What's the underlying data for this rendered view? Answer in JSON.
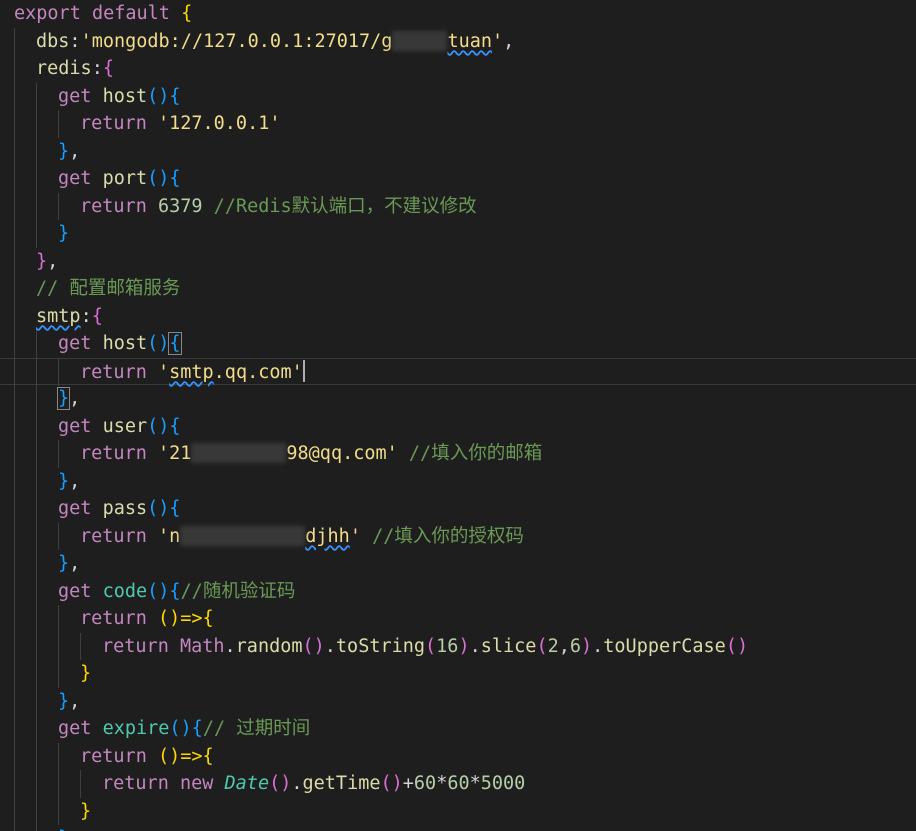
{
  "colors": {
    "keyword": "#c586c0",
    "control": "#c586c0",
    "variable": "#9cdcfe",
    "property": "#9cdcfe",
    "function": "#dcdcaa",
    "string": "#ce9178",
    "number": "#b5cea8",
    "comment": "#6a9955",
    "plain": "#d4d4d4",
    "class": "#4ec9b0",
    "bracket1": "#ffd700",
    "bracket2": "#da70d6",
    "bracket3": "#179fff"
  },
  "lines": [
    {
      "indent": 0,
      "tokens": [
        {
          "t": "export",
          "c": "#c586c0"
        },
        {
          "t": " "
        },
        {
          "t": "default",
          "c": "#c586c0"
        },
        {
          "t": " "
        },
        {
          "t": "{",
          "c": "#ffd700"
        }
      ]
    },
    {
      "indent": 1,
      "tokens": [
        {
          "t": "dbs",
          "c": "#dcdcaa"
        },
        {
          "t": ":",
          "c": "#d4d4d4"
        },
        {
          "t": "'mongodb://127.0.0.1:27017/",
          "c": "#f1dd8a"
        },
        {
          "t": "g",
          "c": "#f1dd8a"
        },
        {
          "redact": 55
        },
        {
          "t": "tuan",
          "c": "#f1dd8a",
          "squig": true
        },
        {
          "t": "'",
          "c": "#f1dd8a"
        },
        {
          "t": ",",
          "c": "#d4d4d4"
        }
      ]
    },
    {
      "indent": 1,
      "tokens": [
        {
          "t": "redis",
          "c": "#dcdcaa"
        },
        {
          "t": ":",
          "c": "#d4d4d4"
        },
        {
          "t": "{",
          "c": "#da70d6"
        }
      ]
    },
    {
      "indent": 2,
      "tokens": [
        {
          "t": "get",
          "c": "#c586c0"
        },
        {
          "t": " "
        },
        {
          "t": "host",
          "c": "#dcdcaa"
        },
        {
          "t": "()",
          "c": "#179fff"
        },
        {
          "t": "{",
          "c": "#179fff"
        }
      ]
    },
    {
      "indent": 3,
      "tokens": [
        {
          "t": "return",
          "c": "#c586c0"
        },
        {
          "t": " "
        },
        {
          "t": "'127.0.0.1'",
          "c": "#f1dd8a"
        }
      ]
    },
    {
      "indent": 2,
      "tokens": [
        {
          "t": "}",
          "c": "#179fff"
        },
        {
          "t": ",",
          "c": "#d4d4d4"
        }
      ]
    },
    {
      "indent": 2,
      "tokens": [
        {
          "t": "get",
          "c": "#c586c0"
        },
        {
          "t": " "
        },
        {
          "t": "port",
          "c": "#dcdcaa"
        },
        {
          "t": "()",
          "c": "#179fff"
        },
        {
          "t": "{",
          "c": "#179fff"
        }
      ]
    },
    {
      "indent": 3,
      "tokens": [
        {
          "t": "return",
          "c": "#c586c0"
        },
        {
          "t": " "
        },
        {
          "t": "6379",
          "c": "#b5cea8"
        },
        {
          "t": " "
        },
        {
          "t": "//Redis默认端口，不建议修改",
          "c": "#6a9955"
        }
      ]
    },
    {
      "indent": 2,
      "tokens": [
        {
          "t": "}",
          "c": "#179fff"
        }
      ]
    },
    {
      "indent": 1,
      "tokens": [
        {
          "t": "}",
          "c": "#da70d6"
        },
        {
          "t": ",",
          "c": "#d4d4d4"
        }
      ]
    },
    {
      "indent": 1,
      "tokens": [
        {
          "t": "// 配置邮箱服务",
          "c": "#6a9955"
        }
      ]
    },
    {
      "indent": 1,
      "tokens": [
        {
          "t": "smtp",
          "c": "#dcdcaa",
          "squig": true
        },
        {
          "t": ":",
          "c": "#d4d4d4"
        },
        {
          "t": "{",
          "c": "#da70d6"
        }
      ]
    },
    {
      "indent": 2,
      "tokens": [
        {
          "t": "get",
          "c": "#c586c0"
        },
        {
          "t": " "
        },
        {
          "t": "host",
          "c": "#dcdcaa"
        },
        {
          "t": "()",
          "c": "#179fff"
        },
        {
          "t": "{",
          "c": "#179fff",
          "match": true
        }
      ]
    },
    {
      "indent": 3,
      "current": true,
      "tokens": [
        {
          "t": "return",
          "c": "#c586c0"
        },
        {
          "t": " "
        },
        {
          "t": "'",
          "c": "#f1dd8a"
        },
        {
          "t": "smtp",
          "c": "#f1dd8a",
          "squig": true
        },
        {
          "t": ".qq.com'",
          "c": "#f1dd8a"
        },
        {
          "cursor": true
        }
      ]
    },
    {
      "indent": 2,
      "tokens": [
        {
          "t": "}",
          "c": "#179fff",
          "match": true
        },
        {
          "t": ",",
          "c": "#d4d4d4"
        }
      ]
    },
    {
      "indent": 2,
      "tokens": [
        {
          "t": "get",
          "c": "#c586c0"
        },
        {
          "t": " "
        },
        {
          "t": "user",
          "c": "#dcdcaa"
        },
        {
          "t": "()",
          "c": "#179fff"
        },
        {
          "t": "{",
          "c": "#179fff"
        }
      ]
    },
    {
      "indent": 3,
      "tokens": [
        {
          "t": "return",
          "c": "#c586c0"
        },
        {
          "t": " "
        },
        {
          "t": "'21",
          "c": "#f1dd8a"
        },
        {
          "redact": 95
        },
        {
          "t": "98@qq.com'",
          "c": "#f1dd8a"
        },
        {
          "t": " "
        },
        {
          "t": "//填入你的邮箱",
          "c": "#6a9955"
        }
      ]
    },
    {
      "indent": 2,
      "tokens": [
        {
          "t": "}",
          "c": "#179fff"
        },
        {
          "t": ",",
          "c": "#d4d4d4"
        }
      ]
    },
    {
      "indent": 2,
      "tokens": [
        {
          "t": "get",
          "c": "#c586c0"
        },
        {
          "t": " "
        },
        {
          "t": "pass",
          "c": "#dcdcaa"
        },
        {
          "t": "()",
          "c": "#179fff"
        },
        {
          "t": "{",
          "c": "#179fff"
        }
      ]
    },
    {
      "indent": 3,
      "tokens": [
        {
          "t": "return",
          "c": "#c586c0"
        },
        {
          "t": " "
        },
        {
          "t": "'n",
          "c": "#f1dd8a"
        },
        {
          "redact": 125
        },
        {
          "t": "djhh",
          "c": "#f1dd8a",
          "squig": true
        },
        {
          "t": "'",
          "c": "#f1dd8a"
        },
        {
          "t": " "
        },
        {
          "t": "//填入你的授权码",
          "c": "#6a9955"
        }
      ]
    },
    {
      "indent": 2,
      "tokens": [
        {
          "t": "}",
          "c": "#179fff"
        },
        {
          "t": ",",
          "c": "#d4d4d4"
        }
      ]
    },
    {
      "indent": 2,
      "tokens": [
        {
          "t": "get",
          "c": "#c586c0"
        },
        {
          "t": " "
        },
        {
          "t": "code",
          "c": "#4ec9b0"
        },
        {
          "t": "()",
          "c": "#179fff"
        },
        {
          "t": "{",
          "c": "#179fff"
        },
        {
          "t": "//随机验证码",
          "c": "#6a9955"
        }
      ]
    },
    {
      "indent": 3,
      "tokens": [
        {
          "t": "return",
          "c": "#c586c0"
        },
        {
          "t": " "
        },
        {
          "t": "()=>{",
          "c": "#ffd700"
        }
      ]
    },
    {
      "indent": 4,
      "tokens": [
        {
          "t": "return",
          "c": "#c586c0"
        },
        {
          "t": " "
        },
        {
          "t": "Math",
          "c": "#c586c0"
        },
        {
          "t": ".",
          "c": "#d4d4d4"
        },
        {
          "t": "random",
          "c": "#dcdcaa"
        },
        {
          "t": "()",
          "c": "#da70d6"
        },
        {
          "t": ".",
          "c": "#d4d4d4"
        },
        {
          "t": "toString",
          "c": "#dcdcaa"
        },
        {
          "t": "(",
          "c": "#da70d6"
        },
        {
          "t": "16",
          "c": "#b5cea8"
        },
        {
          "t": ")",
          "c": "#da70d6"
        },
        {
          "t": ".",
          "c": "#d4d4d4"
        },
        {
          "t": "slice",
          "c": "#dcdcaa"
        },
        {
          "t": "(",
          "c": "#da70d6"
        },
        {
          "t": "2",
          "c": "#b5cea8"
        },
        {
          "t": ",",
          "c": "#d4d4d4"
        },
        {
          "t": "6",
          "c": "#b5cea8"
        },
        {
          "t": ")",
          "c": "#da70d6"
        },
        {
          "t": ".",
          "c": "#d4d4d4"
        },
        {
          "t": "toUpperCase",
          "c": "#dcdcaa"
        },
        {
          "t": "()",
          "c": "#da70d6"
        }
      ]
    },
    {
      "indent": 3,
      "tokens": [
        {
          "t": "}",
          "c": "#ffd700"
        }
      ]
    },
    {
      "indent": 2,
      "tokens": [
        {
          "t": "}",
          "c": "#179fff"
        },
        {
          "t": ",",
          "c": "#d4d4d4"
        }
      ]
    },
    {
      "indent": 2,
      "tokens": [
        {
          "t": "get",
          "c": "#c586c0"
        },
        {
          "t": " "
        },
        {
          "t": "expire",
          "c": "#4ec9b0"
        },
        {
          "t": "()",
          "c": "#179fff"
        },
        {
          "t": "{",
          "c": "#179fff"
        },
        {
          "t": "// 过期时间",
          "c": "#6a9955"
        }
      ]
    },
    {
      "indent": 3,
      "tokens": [
        {
          "t": "return",
          "c": "#c586c0"
        },
        {
          "t": " "
        },
        {
          "t": "()=>{",
          "c": "#ffd700"
        }
      ]
    },
    {
      "indent": 4,
      "tokens": [
        {
          "t": "return",
          "c": "#c586c0"
        },
        {
          "t": " "
        },
        {
          "t": "new",
          "c": "#c586c0"
        },
        {
          "t": " "
        },
        {
          "t": "Date",
          "c": "#4ec9b0",
          "italic": true
        },
        {
          "t": "()",
          "c": "#da70d6"
        },
        {
          "t": ".",
          "c": "#d4d4d4"
        },
        {
          "t": "getTime",
          "c": "#dcdcaa"
        },
        {
          "t": "()",
          "c": "#da70d6"
        },
        {
          "t": "+",
          "c": "#d4d4d4"
        },
        {
          "t": "60",
          "c": "#b5cea8"
        },
        {
          "t": "*",
          "c": "#d4d4d4"
        },
        {
          "t": "60",
          "c": "#b5cea8"
        },
        {
          "t": "*",
          "c": "#d4d4d4"
        },
        {
          "t": "5000",
          "c": "#b5cea8"
        }
      ]
    },
    {
      "indent": 3,
      "tokens": [
        {
          "t": "}",
          "c": "#ffd700"
        }
      ]
    },
    {
      "indent": 2,
      "tokens": [
        {
          "t": "}",
          "c": "#179fff"
        },
        {
          "t": ",",
          "c": "#d4d4d4"
        }
      ]
    }
  ]
}
